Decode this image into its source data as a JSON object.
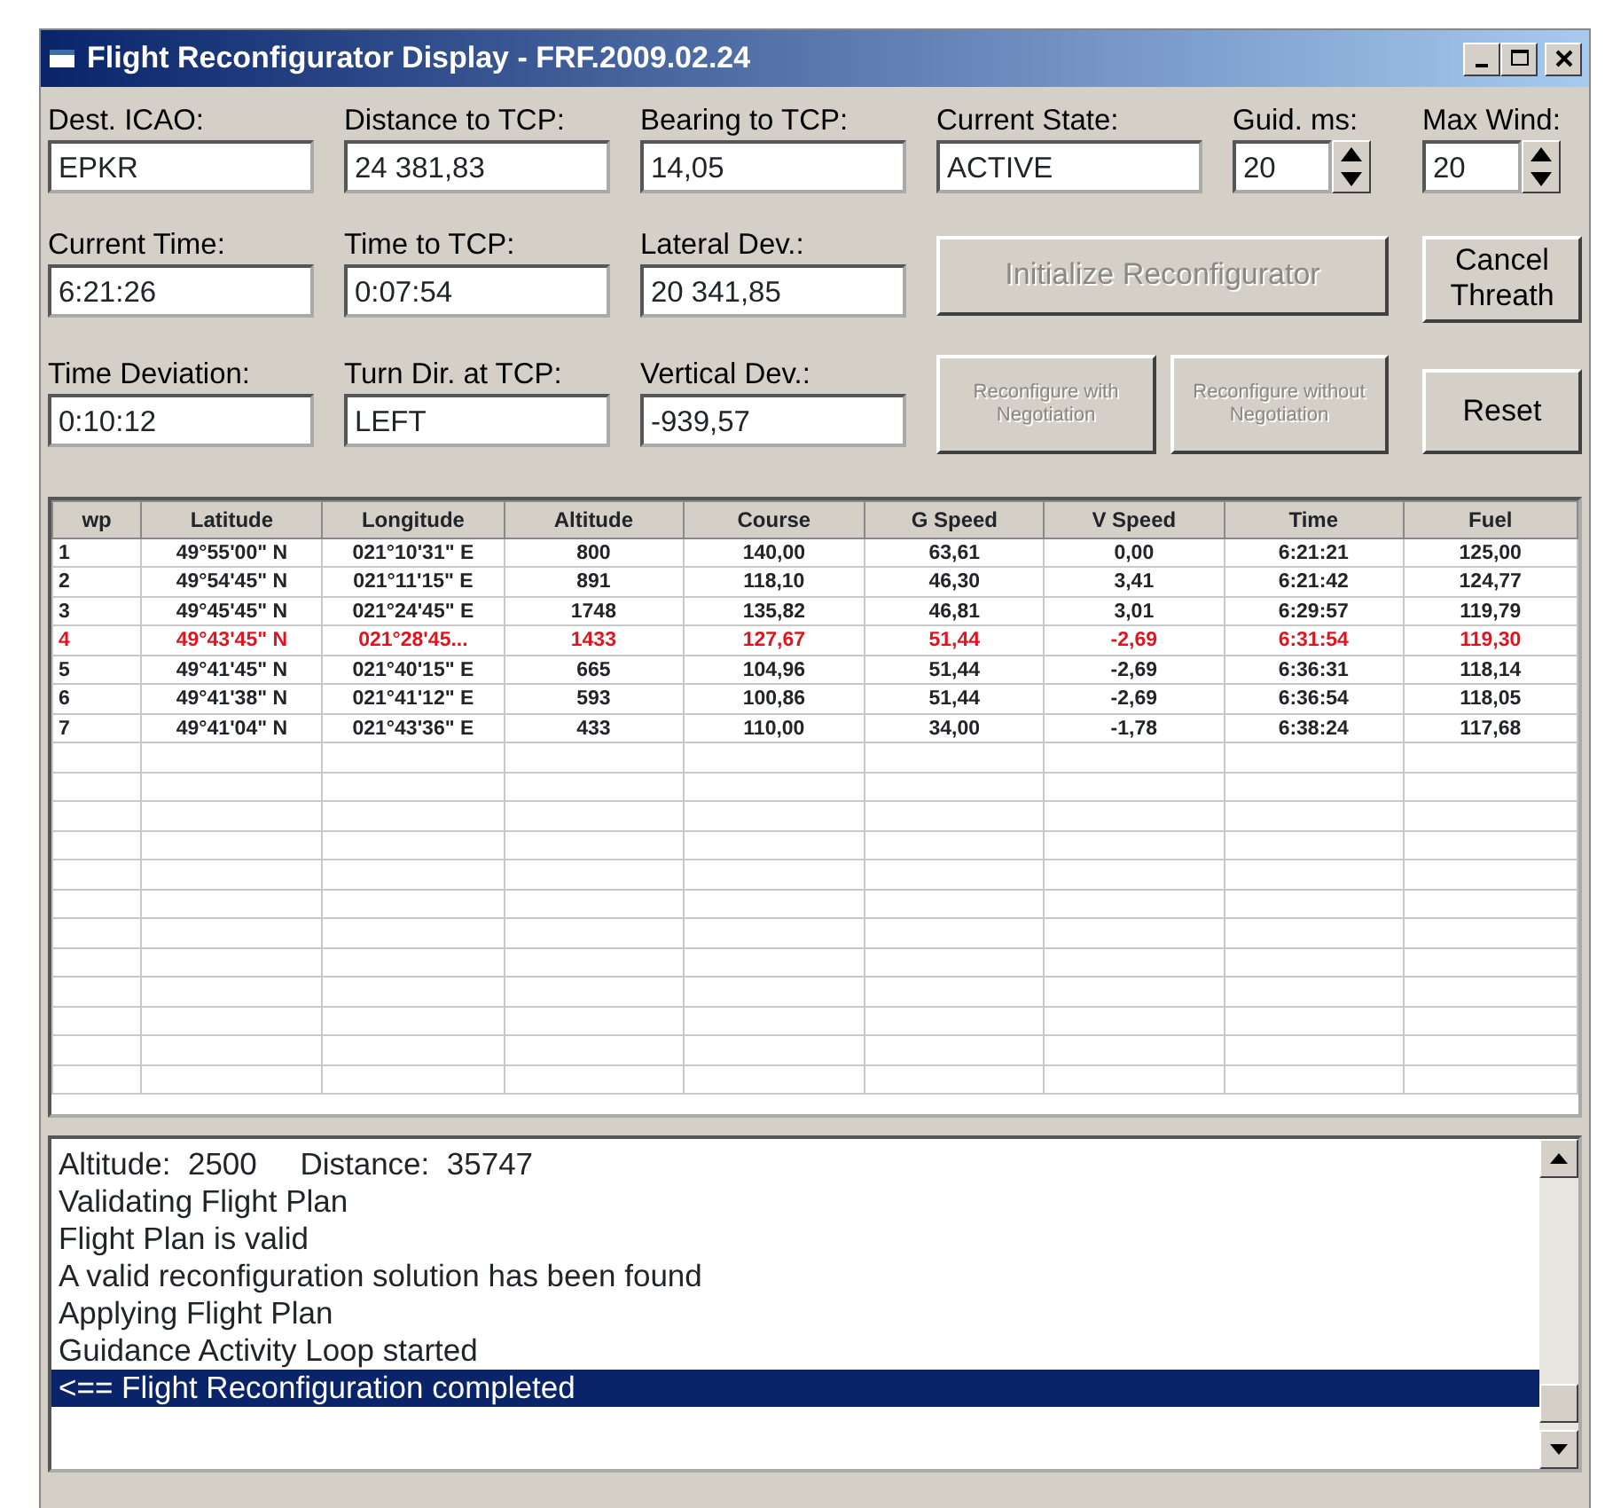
{
  "window": {
    "title": "Flight Reconfigurator Display - FRF.2009.02.24"
  },
  "fields": [
    {
      "label": "Dest. ICAO:",
      "value": "EPKR"
    },
    {
      "label": "Distance to TCP:",
      "value": "24 381,83"
    },
    {
      "label": "Bearing to TCP:",
      "value": "14,05"
    },
    {
      "label": "Current State:",
      "value": "ACTIVE"
    },
    {
      "label": "Guid. ms:",
      "value": "20",
      "kind": "spin"
    },
    {
      "label": "Max Wind:",
      "value": "20",
      "kind": "spin"
    },
    {
      "label": "Current Time:",
      "value": "6:21:26"
    },
    {
      "label": "Time to TCP:",
      "value": "0:07:54"
    },
    {
      "label": "Lateral Dev.:",
      "value": "20 341,85"
    },
    {
      "label": "Time Deviation:",
      "value": "0:10:12"
    },
    {
      "label": "Turn Dir. at TCP:",
      "value": "LEFT"
    },
    {
      "label": "Vertical Dev.:",
      "value": "-939,57"
    }
  ],
  "buttons": [
    {
      "label": "Initialize Reconfigurator",
      "disabled": true
    },
    {
      "label": "Cancel Threath",
      "disabled": false
    },
    {
      "label": "Reconfigure with Negotiation",
      "disabled": true
    },
    {
      "label": "Reconfigure without Negotiation",
      "disabled": true
    },
    {
      "label": "Reset",
      "disabled": false
    }
  ],
  "table": {
    "columns": [
      "wp",
      "Latitude",
      "Longitude",
      "Altitude",
      "Course",
      "G Speed",
      "V Speed",
      "Time",
      "Fuel"
    ],
    "rows": [
      {
        "cells": [
          "1",
          "49°55'00\" N",
          "021°10'31\" E",
          "800",
          "140,00",
          "63,61",
          "0,00",
          "6:21:21",
          "125,00"
        ],
        "current": false
      },
      {
        "cells": [
          "2",
          "49°54'45\" N",
          "021°11'15\" E",
          "891",
          "118,10",
          "46,30",
          "3,41",
          "6:21:42",
          "124,77"
        ],
        "current": false
      },
      {
        "cells": [
          "3",
          "49°45'45\" N",
          "021°24'45\" E",
          "1748",
          "135,82",
          "46,81",
          "3,01",
          "6:29:57",
          "119,79"
        ],
        "current": false
      },
      {
        "cells": [
          "4",
          "49°43'45\" N",
          "021°28'45...",
          "1433",
          "127,67",
          "51,44",
          "-2,69",
          "6:31:54",
          "119,30"
        ],
        "current": true
      },
      {
        "cells": [
          "5",
          "49°41'45\" N",
          "021°40'15\" E",
          "665",
          "104,96",
          "51,44",
          "-2,69",
          "6:36:31",
          "118,14"
        ],
        "current": false
      },
      {
        "cells": [
          "6",
          "49°41'38\" N",
          "021°41'12\" E",
          "593",
          "100,86",
          "51,44",
          "-2,69",
          "6:36:54",
          "118,05"
        ],
        "current": false
      },
      {
        "cells": [
          "7",
          "49°41'04\" N",
          "021°43'36\" E",
          "433",
          "110,00",
          "34,00",
          "-1,78",
          "6:38:24",
          "117,68"
        ],
        "current": false
      }
    ]
  },
  "log": [
    {
      "text": "Altitude:  2500     Distance:  35747",
      "selected": false
    },
    {
      "text": "Validating Flight Plan",
      "selected": false
    },
    {
      "text": "Flight Plan is valid",
      "selected": false
    },
    {
      "text": "A valid reconfiguration solution has been found",
      "selected": false
    },
    {
      "text": "Applying Flight Plan",
      "selected": false
    },
    {
      "text": "Guidance Activity Loop started",
      "selected": false
    },
    {
      "text": "<== Flight Reconfiguration completed",
      "selected": true
    }
  ]
}
